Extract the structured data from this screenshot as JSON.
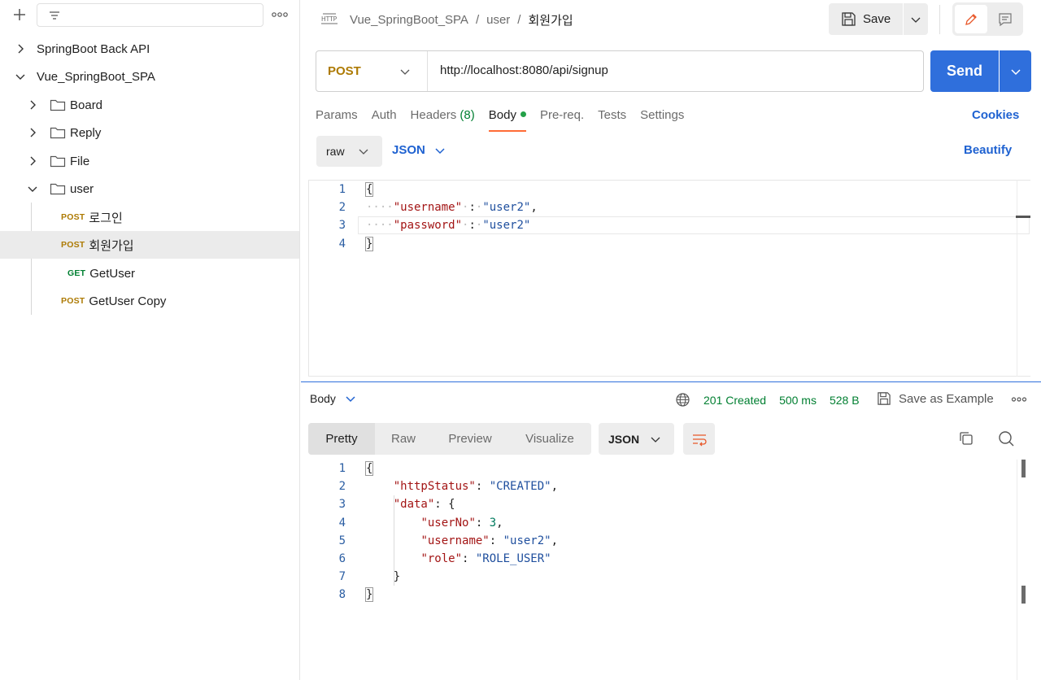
{
  "sidebar": {
    "tree": [
      {
        "label": "SpringBoot Back API",
        "type": "collection",
        "expanded": false
      },
      {
        "label": "Vue_SpringBoot_SPA",
        "type": "collection",
        "expanded": true
      },
      {
        "label": "Board",
        "type": "folder",
        "expanded": false
      },
      {
        "label": "Reply",
        "type": "folder",
        "expanded": false
      },
      {
        "label": "File",
        "type": "folder",
        "expanded": false
      },
      {
        "label": "user",
        "type": "folder",
        "expanded": true
      }
    ],
    "requests": [
      {
        "method": "POST",
        "label": "로그인"
      },
      {
        "method": "POST",
        "label": "회원가입",
        "selected": true
      },
      {
        "method": "GET",
        "label": "GetUser"
      },
      {
        "method": "POST",
        "label": "GetUser Copy"
      }
    ]
  },
  "header": {
    "icon_text": "HTTP",
    "breadcrumb": [
      "Vue_SpringBoot_SPA",
      "user",
      "회원가입"
    ],
    "separator": "/",
    "save_label": "Save"
  },
  "request": {
    "method": "POST",
    "url": "http://localhost:8080/api/signup",
    "send_label": "Send",
    "tabs": {
      "params": "Params",
      "auth": "Auth",
      "headers": "Headers",
      "headers_count": "(8)",
      "body": "Body",
      "prereq": "Pre-req.",
      "tests": "Tests",
      "settings": "Settings"
    },
    "cookies": "Cookies",
    "body_mode": "raw",
    "body_lang": "JSON",
    "beautify": "Beautify",
    "body_lines": {
      "l1": "{",
      "l2_key": "\"username\"",
      "l2_val": "\"user2\"",
      "l3_key": "\"password\"",
      "l3_val": "\"user2\"",
      "l4": "}"
    }
  },
  "response": {
    "section_label": "Body",
    "status": "201 Created",
    "time": "500 ms",
    "size": "528 B",
    "save_example": "Save as Example",
    "views": [
      "Pretty",
      "Raw",
      "Preview",
      "Visualize"
    ],
    "format": "JSON",
    "lines": {
      "k_httpStatus": "\"httpStatus\"",
      "v_httpStatus": "\"CREATED\"",
      "k_data": "\"data\"",
      "k_userNo": "\"userNo\"",
      "v_userNo": "3",
      "k_username": "\"username\"",
      "v_username": "\"user2\"",
      "k_role": "\"role\"",
      "v_role": "\"ROLE_USER\""
    }
  },
  "colors": {
    "accent": "#2f6fdc",
    "post": "#ad7a03",
    "get": "#007f31",
    "active_tab": "#ff6c37",
    "status_ok": "#007f31"
  }
}
